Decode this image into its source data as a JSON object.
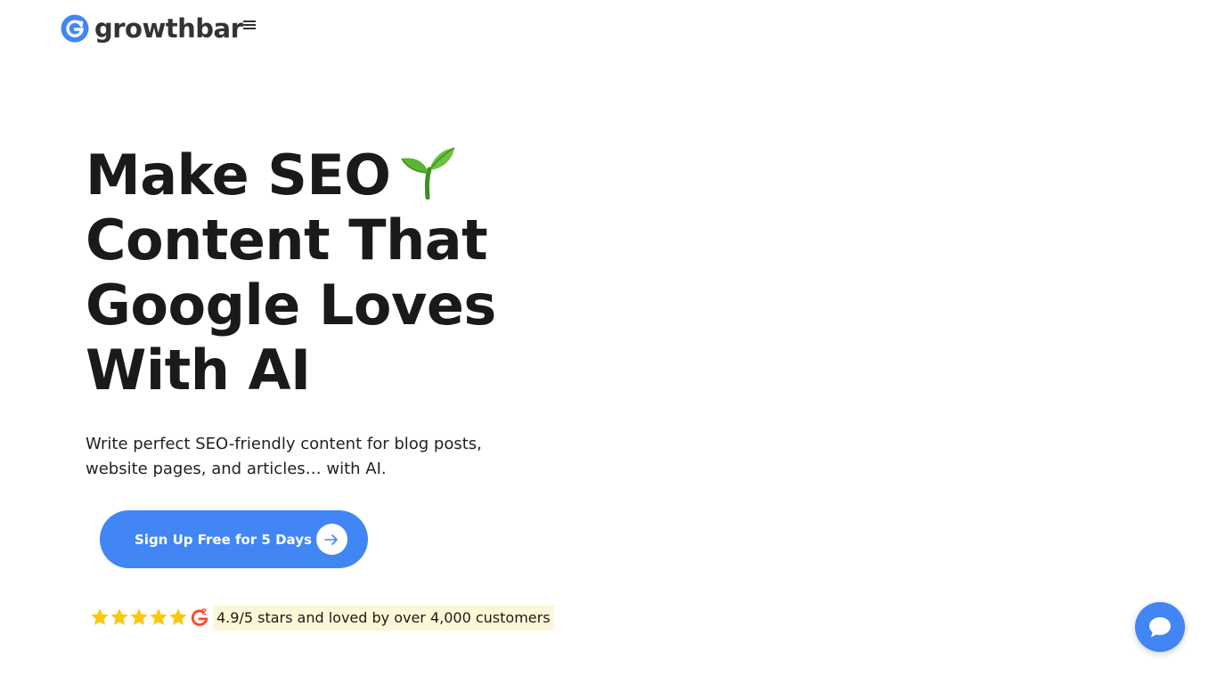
{
  "header": {
    "logo_text": "growthbar",
    "menu_icon": "hamburger-menu-icon"
  },
  "hero": {
    "title_line_1": "Make SEO",
    "title_line_2": "Content That",
    "title_line_3": "Google Loves",
    "title_line_4": "With AI",
    "title_emoji_icon": "seedling-icon",
    "subtitle": "Write perfect SEO-friendly content for blog posts, website pages, and articles… with AI."
  },
  "cta": {
    "label": "Sign Up Free for 5 Days",
    "icon": "arrow-right-icon"
  },
  "rating": {
    "stars": 5,
    "icon": "g2-logo-icon",
    "text": "4.9/5 stars and loved by over 4,000 customers"
  },
  "chat": {
    "icon": "chat-bubble-icon"
  },
  "colors": {
    "brand_blue": "#4285f4",
    "star_yellow": "#f9c80e",
    "highlight": "#fcf8d7",
    "g2_red": "#ff492c"
  }
}
